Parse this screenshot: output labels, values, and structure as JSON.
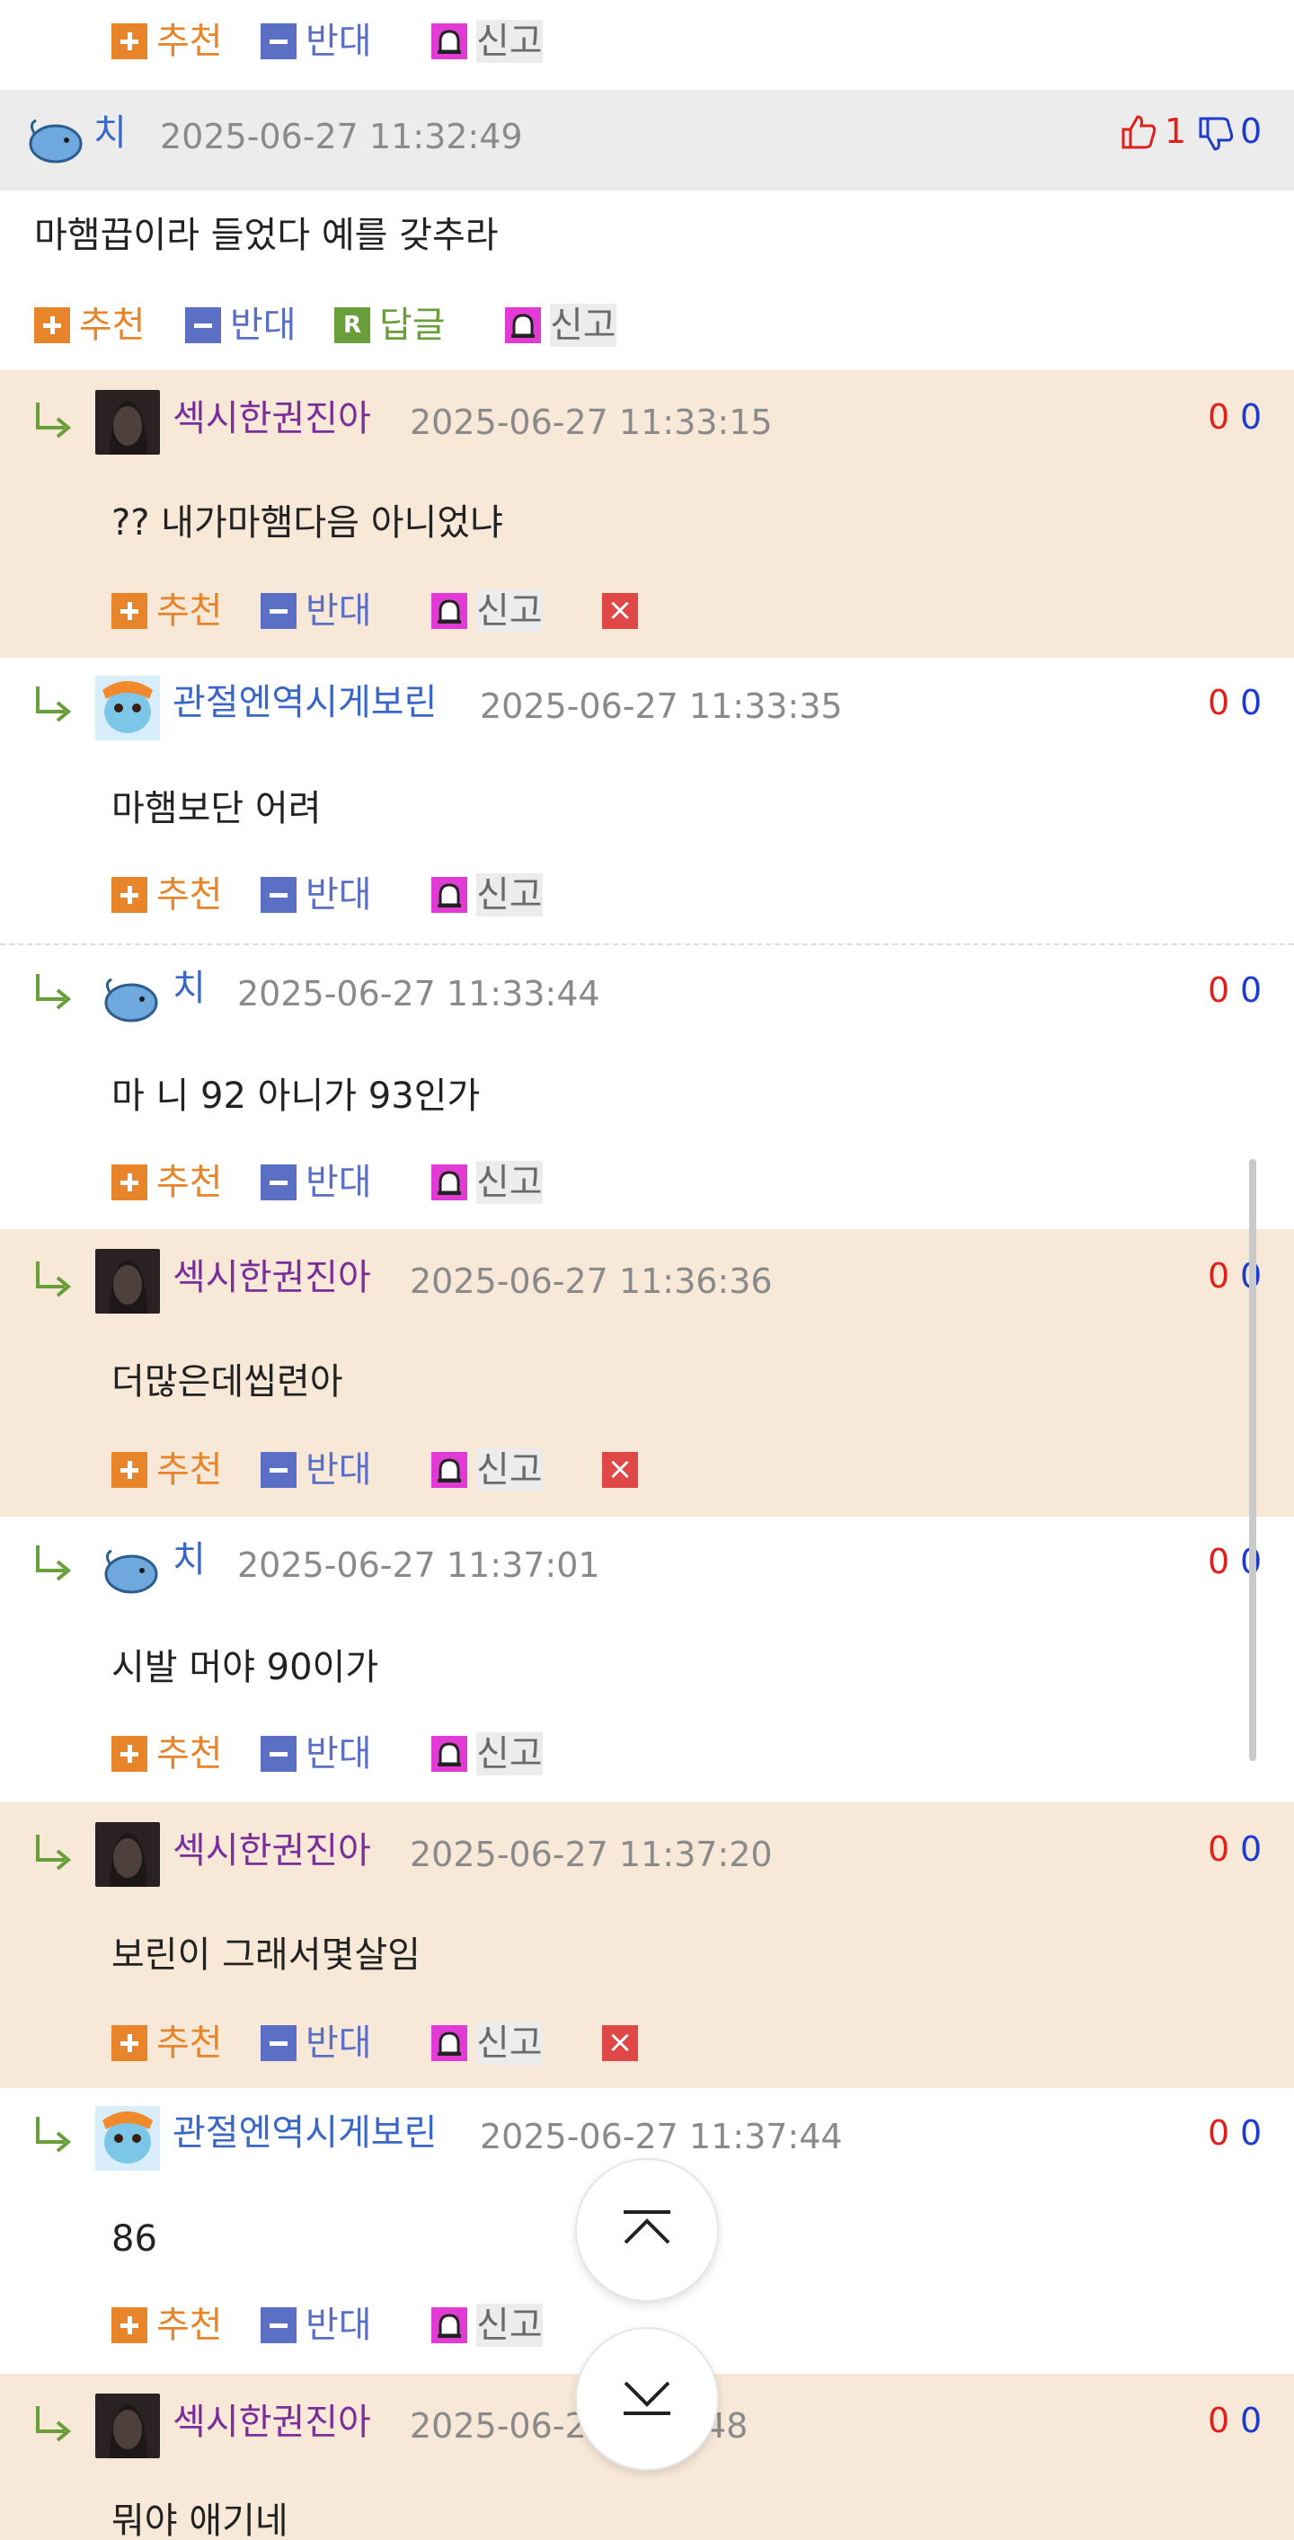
{
  "actions": {
    "recommend": "추천",
    "oppose": "반대",
    "reply": "답글",
    "report": "신고",
    "reply_letter": "R"
  },
  "comments": [
    {
      "nick": "치",
      "date": "2025-06-27 11:32:49",
      "up": "1",
      "down": "0",
      "text": "마햄끕이라 들었다 예를 갖추라"
    },
    {
      "nick": "섹시한권진아",
      "date": "2025-06-27 11:33:15",
      "up": "0",
      "down": "0",
      "text": "?? 내가마햄다음 아니었냐"
    },
    {
      "nick": "관절엔역시게보린",
      "date": "2025-06-27 11:33:35",
      "up": "0",
      "down": "0",
      "text": "마햄보단 어려"
    },
    {
      "nick": "치",
      "date": "2025-06-27 11:33:44",
      "up": "0",
      "down": "0",
      "text": "마 니 92 아니가 93인가"
    },
    {
      "nick": "섹시한권진아",
      "date": "2025-06-27 11:36:36",
      "up": "0",
      "down": "0",
      "text": "더많은데씹련아"
    },
    {
      "nick": "치",
      "date": "2025-06-27 11:37:01",
      "up": "0",
      "down": "0",
      "text": "시발 머야 90이가"
    },
    {
      "nick": "섹시한권진아",
      "date": "2025-06-27 11:37:20",
      "up": "0",
      "down": "0",
      "text": "보린이 그래서몇살임"
    },
    {
      "nick": "관절엔역시게보린",
      "date": "2025-06-27 11:37:44",
      "up": "0",
      "down": "0",
      "text": "86"
    },
    {
      "nick": "섹시한권진아",
      "date": "2025-06-2",
      "date_tail": "48",
      "up": "0",
      "down": "0",
      "text": "뭐야 애기네"
    }
  ],
  "colors": {
    "beige_background": "#f7e8d8",
    "header_gray": "#ececec",
    "nick_purple": "#7b2e9a",
    "nick_blue": "#3a66c6",
    "vote_up_red": "#e0201a",
    "vote_down_blue": "#1e3bd0",
    "recommend_orange": "#e8842a",
    "oppose_indigo": "#5b6fc4"
  },
  "icons": {
    "reply_indent": "reply-arrow-icon",
    "thumbs_up": "thumbs-up-icon",
    "thumbs_down": "thumbs-down-icon",
    "report": "bell-icon",
    "delete": "close-icon",
    "scroll_top": "chevron-up-bar-icon",
    "scroll_bottom": "chevron-down-bar-icon"
  }
}
